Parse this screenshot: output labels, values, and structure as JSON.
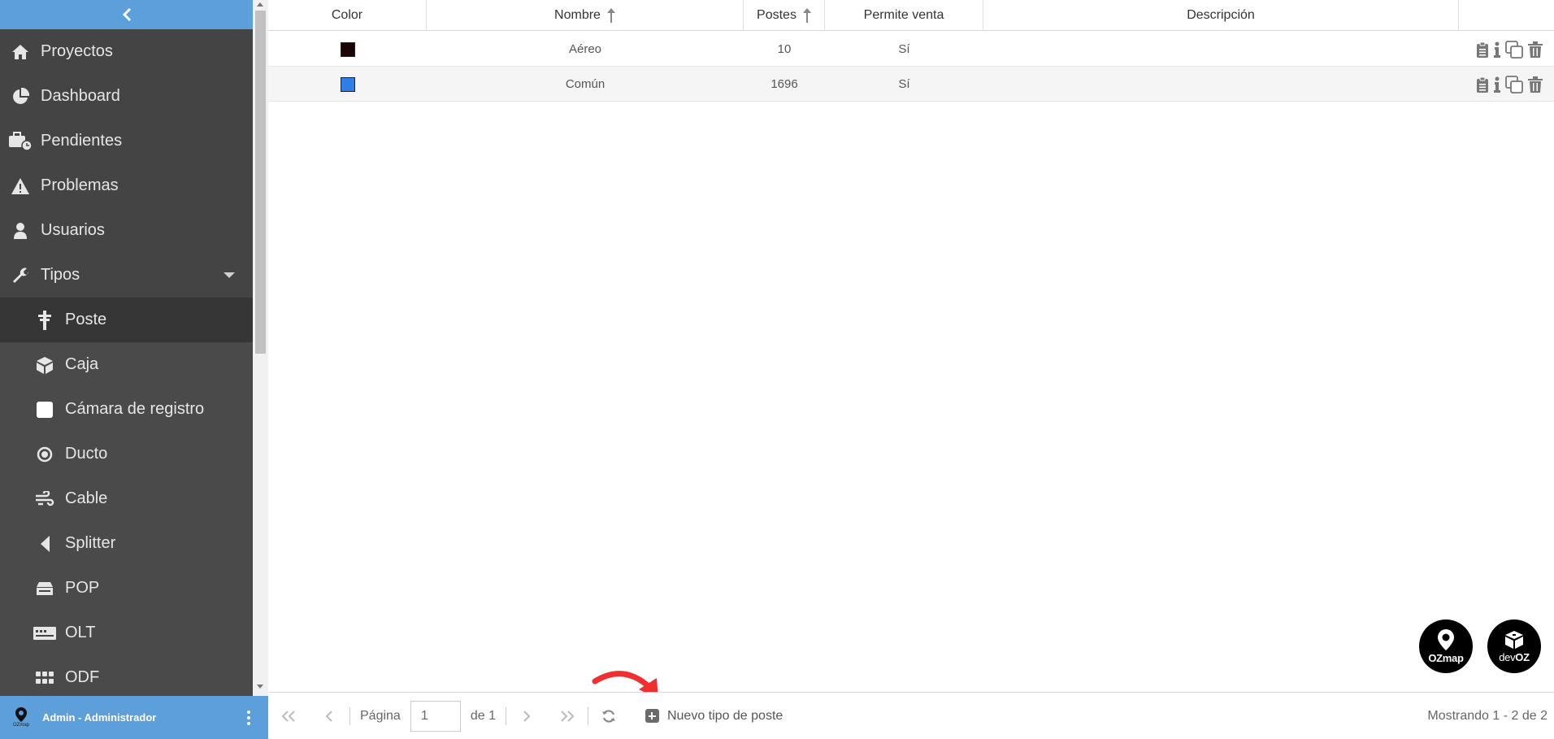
{
  "sidebar": {
    "items": [
      {
        "label": "Proyectos",
        "icon": "home-icon"
      },
      {
        "label": "Dashboard",
        "icon": "pie-chart-icon"
      },
      {
        "label": "Pendientes",
        "icon": "briefcase-clock-icon"
      },
      {
        "label": "Problemas",
        "icon": "warning-icon"
      },
      {
        "label": "Usuarios",
        "icon": "user-icon"
      },
      {
        "label": "Tipos",
        "icon": "wrench-icon"
      }
    ],
    "subitems": [
      {
        "label": "Poste",
        "icon": "pole-icon"
      },
      {
        "label": "Caja",
        "icon": "box-icon"
      },
      {
        "label": "Cámara de registro",
        "icon": "square-icon"
      },
      {
        "label": "Ducto",
        "icon": "dot-circle-icon"
      },
      {
        "label": "Cable",
        "icon": "cable-icon"
      },
      {
        "label": "Splitter",
        "icon": "triangle-left-icon"
      },
      {
        "label": "POP",
        "icon": "pop-icon"
      },
      {
        "label": "OLT",
        "icon": "olt-icon"
      },
      {
        "label": "ODF",
        "icon": "grid-icon"
      }
    ]
  },
  "user": {
    "name": "Admin - Administrador",
    "logo_text": "OZmap"
  },
  "table": {
    "headers": [
      "Color",
      "Nombre",
      "Postes",
      "Permite venta",
      "Descripción"
    ],
    "rows": [
      {
        "color": "#1a0505",
        "nombre": "Aéreo",
        "postes": "10",
        "venta": "Sí",
        "descripcion": ""
      },
      {
        "color": "#2f7ee6",
        "nombre": "Común",
        "postes": "1696",
        "venta": "Sí",
        "descripcion": ""
      }
    ]
  },
  "footer": {
    "page_label": "Página",
    "page_value": "1",
    "of_label": "de 1",
    "new_label": "Nuevo tipo de poste",
    "showing": "Mostrando 1 - 2 de 2"
  },
  "badges": {
    "ozmap": "OZmap",
    "devoz_a": "dev",
    "devoz_b": "OZ"
  },
  "colors": {
    "accent": "#5c9fdb",
    "sidebar": "#444444",
    "arrow": "#f03030"
  }
}
